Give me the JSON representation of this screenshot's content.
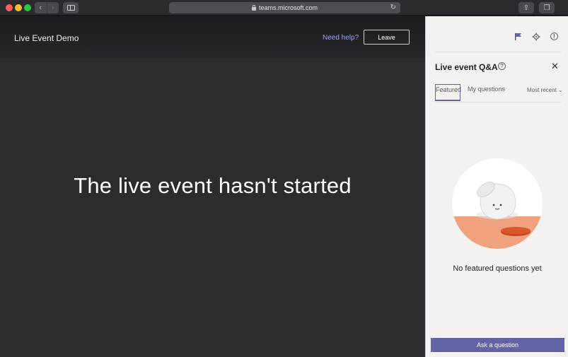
{
  "browser": {
    "url": "teams.microsoft.com"
  },
  "stage": {
    "event_title": "Live Event Demo",
    "help_link": "Need help?",
    "leave_label": "Leave",
    "status_message": "The live event hasn't started"
  },
  "qa_panel": {
    "title": "Live event Q&A",
    "tabs": [
      {
        "label": "Featured"
      },
      {
        "label": "My questions"
      }
    ],
    "sort_label": "Most recent",
    "empty_message": "No featured questions yet",
    "ask_button": "Ask a question"
  },
  "colors": {
    "accent": "#6264a7",
    "link": "#9ea2ff",
    "stage_background": "#2c2b30",
    "panel_background": "#f3f2f1"
  },
  "icons": [
    "back-icon",
    "forward-icon",
    "sidebar-icon",
    "lock-icon",
    "reload-icon",
    "share-icon",
    "tabs-icon",
    "new-tab-icon",
    "flag-icon",
    "gear-icon",
    "info-icon",
    "help-icon",
    "close-icon",
    "chevron-down-icon"
  ]
}
